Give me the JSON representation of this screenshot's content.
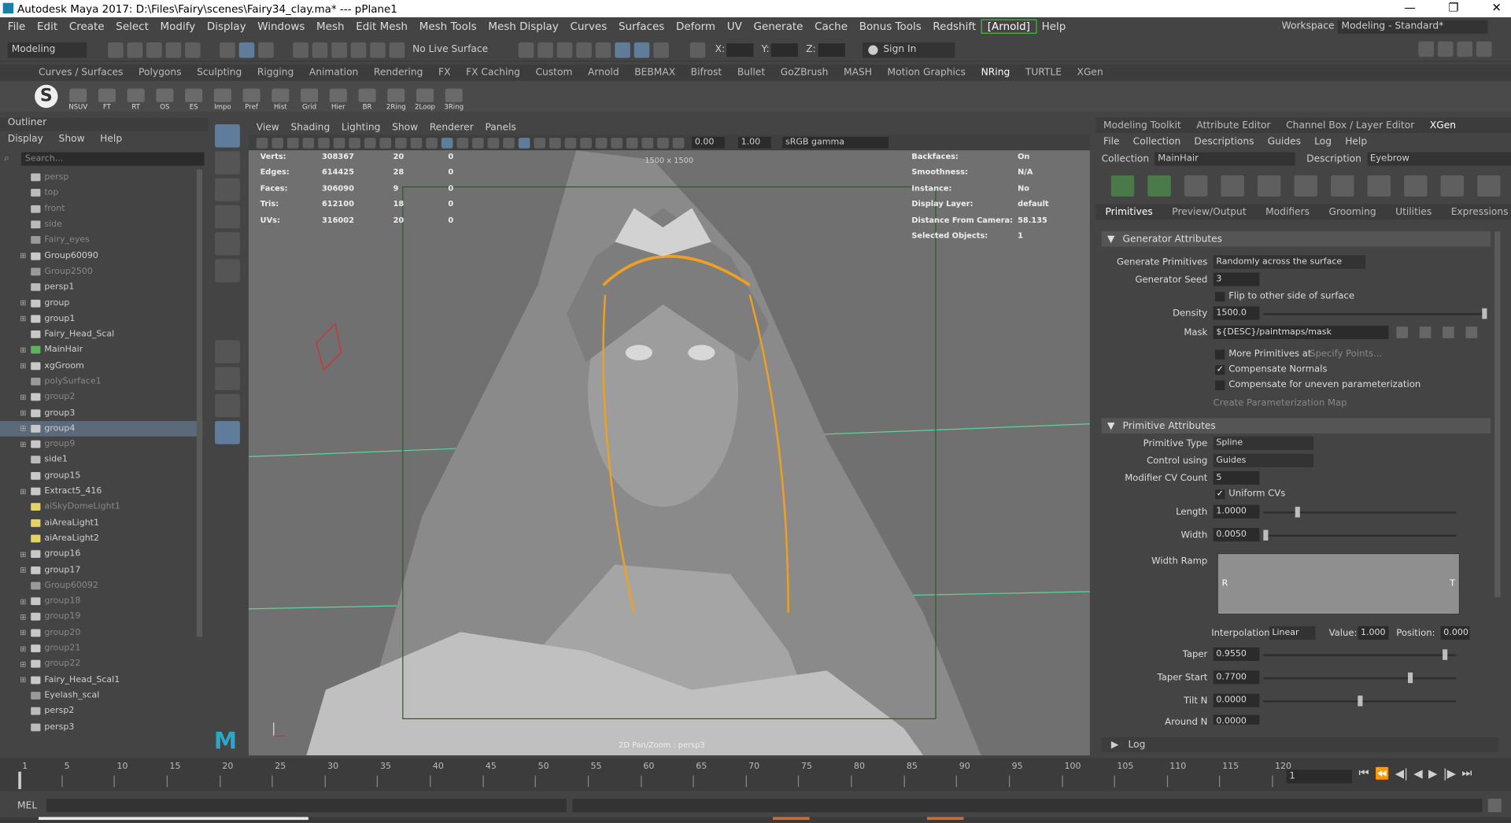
{
  "window": {
    "title": "Autodesk Maya 2017: D:\\Files\\Fairy\\scenes\\Fairy34_clay.ma*   ---   pPlane1"
  },
  "menubar": [
    "File",
    "Edit",
    "Create",
    "Select",
    "Modify",
    "Display",
    "Windows",
    "Mesh",
    "Edit Mesh",
    "Mesh Tools",
    "Mesh Display",
    "Curves",
    "Surfaces",
    "Deform",
    "UV",
    "Generate",
    "Cache",
    "Bonus Tools",
    "Redshift",
    "[Arnold]",
    "Help"
  ],
  "workspace": {
    "label": "Workspace :",
    "value": "Modeling - Standard*"
  },
  "status": {
    "mode": "Modeling",
    "live_surface": "No Live Surface",
    "x": "X:",
    "y": "Y:",
    "z": "Z:",
    "sign_in": "Sign In"
  },
  "shelf_tabs": [
    "Curves / Surfaces",
    "Polygons",
    "Sculpting",
    "Rigging",
    "Animation",
    "Rendering",
    "FX",
    "FX Caching",
    "Custom",
    "Arnold",
    "BEBMAX",
    "Bifrost",
    "Bullet",
    "GoZBrush",
    "MASH",
    "Motion Graphics",
    "NRing",
    "TURTLE",
    "XGen"
  ],
  "shelf_icons": [
    "NSUV",
    "FT",
    "RT",
    "OS",
    "ES",
    "Impo",
    "Pref",
    "Hist",
    "Grid",
    "Hier",
    "BR",
    "2Ring",
    "2Loop",
    "3Ring"
  ],
  "outliner": {
    "title": "Outliner",
    "menu": [
      "Display",
      "Show",
      "Help"
    ],
    "search": "Search...",
    "items": [
      {
        "name": "persp",
        "dim": true,
        "exp": false,
        "ic": "cam"
      },
      {
        "name": "top",
        "dim": true,
        "exp": false,
        "ic": "cam"
      },
      {
        "name": "front",
        "dim": true,
        "exp": false,
        "ic": "cam"
      },
      {
        "name": "side",
        "dim": true,
        "exp": false,
        "ic": "cam"
      },
      {
        "name": "Fairy_eyes",
        "dim": true,
        "exp": false,
        "ic": "mesh"
      },
      {
        "name": "Group60090",
        "dim": false,
        "exp": true,
        "ic": "grp"
      },
      {
        "name": "Group2500",
        "dim": true,
        "exp": false,
        "ic": "mesh"
      },
      {
        "name": "persp1",
        "dim": false,
        "exp": false,
        "ic": "cam"
      },
      {
        "name": "group",
        "dim": false,
        "exp": true,
        "ic": "grp"
      },
      {
        "name": "group1",
        "dim": false,
        "exp": true,
        "ic": "grp"
      },
      {
        "name": "Fairy_Head_Scal",
        "dim": false,
        "exp": false,
        "ic": "grp"
      },
      {
        "name": "MainHair",
        "dim": false,
        "exp": true,
        "ic": "xg"
      },
      {
        "name": "xgGroom",
        "dim": false,
        "exp": true,
        "ic": "grp"
      },
      {
        "name": "polySurface1",
        "dim": true,
        "exp": false,
        "ic": "mesh"
      },
      {
        "name": "group2",
        "dim": true,
        "exp": true,
        "ic": "grp"
      },
      {
        "name": "group3",
        "dim": false,
        "exp": true,
        "ic": "grp"
      },
      {
        "name": "group4",
        "dim": false,
        "exp": true,
        "ic": "grp",
        "sel": true
      },
      {
        "name": "group9",
        "dim": true,
        "exp": true,
        "ic": "grp"
      },
      {
        "name": "side1",
        "dim": false,
        "exp": false,
        "ic": "cam"
      },
      {
        "name": "group15",
        "dim": false,
        "exp": false,
        "ic": "grp"
      },
      {
        "name": "Extract5_416",
        "dim": false,
        "exp": true,
        "ic": "grp"
      },
      {
        "name": "aiSkyDomeLight1",
        "dim": true,
        "exp": false,
        "ic": "light"
      },
      {
        "name": "aiAreaLight1",
        "dim": false,
        "exp": false,
        "ic": "light"
      },
      {
        "name": "aiAreaLight2",
        "dim": false,
        "exp": false,
        "ic": "light"
      },
      {
        "name": "group16",
        "dim": false,
        "exp": true,
        "ic": "grp"
      },
      {
        "name": "group17",
        "dim": false,
        "exp": true,
        "ic": "grp"
      },
      {
        "name": "Group60092",
        "dim": true,
        "exp": false,
        "ic": "mesh"
      },
      {
        "name": "group18",
        "dim": true,
        "exp": true,
        "ic": "grp"
      },
      {
        "name": "group19",
        "dim": true,
        "exp": true,
        "ic": "grp"
      },
      {
        "name": "group20",
        "dim": true,
        "exp": true,
        "ic": "grp"
      },
      {
        "name": "group21",
        "dim": true,
        "exp": true,
        "ic": "grp"
      },
      {
        "name": "group22",
        "dim": true,
        "exp": true,
        "ic": "grp"
      },
      {
        "name": "Fairy_Head_Scal1",
        "dim": false,
        "exp": true,
        "ic": "grp"
      },
      {
        "name": "Eyelash_scal",
        "dim": false,
        "exp": false,
        "ic": "mesh"
      },
      {
        "name": "persp2",
        "dim": false,
        "exp": false,
        "ic": "cam"
      },
      {
        "name": "persp3",
        "dim": false,
        "exp": false,
        "ic": "cam"
      }
    ]
  },
  "viewport": {
    "menu": [
      "View",
      "Shading",
      "Lighting",
      "Show",
      "Renderer",
      "Panels"
    ],
    "exposure": "0.00",
    "gamma": "1.00",
    "color_space": "sRGB gamma",
    "resolution": "1500 x 1500",
    "camera_label": "2D Pan/Zoom : persp3",
    "hud_left": [
      {
        "label": "Verts:",
        "a": "308367",
        "b": "20",
        "c": "0"
      },
      {
        "label": "Edges:",
        "a": "614425",
        "b": "28",
        "c": "0"
      },
      {
        "label": "Faces:",
        "a": "306090",
        "b": "9",
        "c": "0"
      },
      {
        "label": "Tris:",
        "a": "612100",
        "b": "18",
        "c": "0"
      },
      {
        "label": "UVs:",
        "a": "316002",
        "b": "20",
        "c": "0"
      }
    ],
    "hud_right": [
      {
        "label": "Backfaces:",
        "value": "On"
      },
      {
        "label": "Smoothness:",
        "value": "N/A"
      },
      {
        "label": "Instance:",
        "value": "No"
      },
      {
        "label": "Display Layer:",
        "value": "default"
      },
      {
        "label": "Distance From Camera:",
        "value": "58.135"
      },
      {
        "label": "Selected Objects:",
        "value": "1"
      }
    ]
  },
  "right_panel": {
    "tabs": [
      "Modeling Toolkit",
      "Attribute Editor",
      "Channel Box / Layer Editor",
      "XGen"
    ],
    "menu": [
      "File",
      "Collection",
      "Descriptions",
      "Guides",
      "Log",
      "Help"
    ],
    "collection_label": "Collection",
    "collection": "MainHair",
    "description_label": "Description",
    "description": "Eyebrow",
    "subtabs": [
      "Primitives",
      "Preview/Output",
      "Modifiers",
      "Grooming",
      "Utilities",
      "Expressions"
    ],
    "gen_section": "Generator Attributes",
    "generate_primitives_label": "Generate Primitives",
    "generate_primitives": "Randomly across the surface",
    "generator_seed_label": "Generator Seed",
    "generator_seed": "3",
    "flip_label": "Flip to other side of surface",
    "density_label": "Density",
    "density": "1500.0",
    "mask_label": "Mask",
    "mask": "${DESC}/paintmaps/mask",
    "more_prims": "More Primitives at",
    "specify_points": "Specify Points...",
    "comp_normals": "Compensate Normals",
    "comp_uneven": "Compensate for uneven parameterization",
    "create_param": "Create Parameterization Map",
    "prim_section": "Primitive Attributes",
    "prim_type_label": "Primitive Type",
    "prim_type": "Spline",
    "control_label": "Control using",
    "control": "Guides",
    "cv_label": "Modifier CV Count",
    "cv": "5",
    "uniform": "Uniform CVs",
    "length_label": "Length",
    "length": "1.0000",
    "width_label": "Width",
    "width": "0.0050",
    "width_ramp_label": "Width Ramp",
    "ramp_r": "R",
    "ramp_t": "T",
    "interp_label": "Interpolation:",
    "interp": "Linear",
    "value_label": "Value:",
    "value": "1.000",
    "position_label": "Position:",
    "position": "0.000",
    "taper_label": "Taper",
    "taper": "0.9550",
    "taper_start_label": "Taper Start",
    "taper_start": "0.7700",
    "tilt_label": "Tilt N",
    "tilt": "0.0000",
    "around_label": "Around N",
    "around": "0.0000",
    "log": "Log",
    "levels": {
      "density": 1.0,
      "length": 0.17,
      "width": 0.0,
      "taper": 0.955,
      "taper_start": 0.77,
      "tilt": 0.5,
      "around": 0.5
    }
  },
  "timeline": {
    "ticks": [
      "1",
      "5",
      "10",
      "15",
      "20",
      "25",
      "30",
      "35",
      "40",
      "45",
      "50",
      "55",
      "60",
      "65",
      "70",
      "75",
      "80",
      "85",
      "90",
      "95",
      "100",
      "105",
      "110",
      "115",
      "120"
    ],
    "current": "1"
  },
  "cmd": {
    "label": "MEL"
  }
}
